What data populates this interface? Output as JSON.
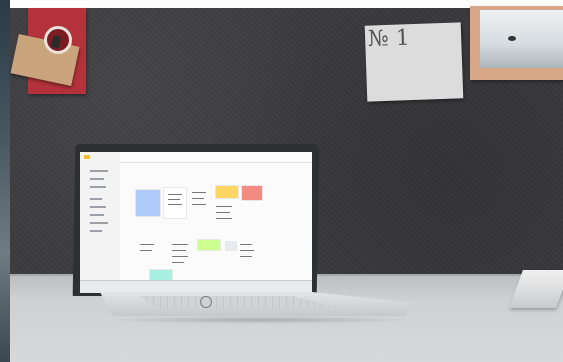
{
  "scene": {
    "num_card_text": "№ 1",
    "colors": {
      "wall": "#3c3c3e",
      "desk": "#cfd1d2",
      "red_card": "#b4333a",
      "kraft_note": "#c9a47d",
      "frame": "#d7a787",
      "laptop_bezel": "#2d2f31",
      "laptop_body": "#e3e4e5",
      "note_blue": "#aecbfa",
      "note_yellow": "#fdd663",
      "note_red": "#f28b82",
      "note_green": "#ccff90"
    },
    "icons": [
      "pushpin-icon",
      "paper-clip-icon",
      "hp-logo-icon"
    ]
  }
}
